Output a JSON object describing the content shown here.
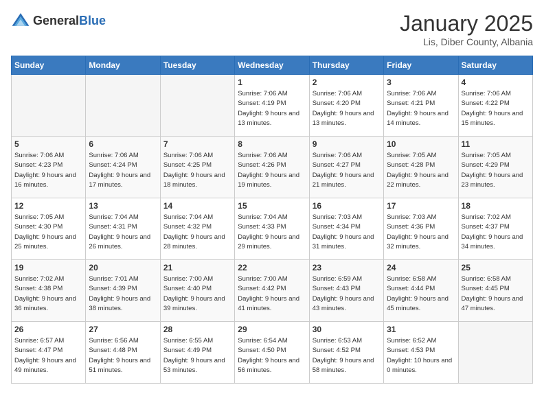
{
  "header": {
    "logo_general": "General",
    "logo_blue": "Blue",
    "month": "January 2025",
    "location": "Lis, Diber County, Albania"
  },
  "days_of_week": [
    "Sunday",
    "Monday",
    "Tuesday",
    "Wednesday",
    "Thursday",
    "Friday",
    "Saturday"
  ],
  "weeks": [
    [
      {
        "num": "",
        "sunrise": "",
        "sunset": "",
        "daylight": "",
        "empty": true
      },
      {
        "num": "",
        "sunrise": "",
        "sunset": "",
        "daylight": "",
        "empty": true
      },
      {
        "num": "",
        "sunrise": "",
        "sunset": "",
        "daylight": "",
        "empty": true
      },
      {
        "num": "1",
        "sunrise": "Sunrise: 7:06 AM",
        "sunset": "Sunset: 4:19 PM",
        "daylight": "Daylight: 9 hours and 13 minutes."
      },
      {
        "num": "2",
        "sunrise": "Sunrise: 7:06 AM",
        "sunset": "Sunset: 4:20 PM",
        "daylight": "Daylight: 9 hours and 13 minutes."
      },
      {
        "num": "3",
        "sunrise": "Sunrise: 7:06 AM",
        "sunset": "Sunset: 4:21 PM",
        "daylight": "Daylight: 9 hours and 14 minutes."
      },
      {
        "num": "4",
        "sunrise": "Sunrise: 7:06 AM",
        "sunset": "Sunset: 4:22 PM",
        "daylight": "Daylight: 9 hours and 15 minutes."
      }
    ],
    [
      {
        "num": "5",
        "sunrise": "Sunrise: 7:06 AM",
        "sunset": "Sunset: 4:23 PM",
        "daylight": "Daylight: 9 hours and 16 minutes."
      },
      {
        "num": "6",
        "sunrise": "Sunrise: 7:06 AM",
        "sunset": "Sunset: 4:24 PM",
        "daylight": "Daylight: 9 hours and 17 minutes."
      },
      {
        "num": "7",
        "sunrise": "Sunrise: 7:06 AM",
        "sunset": "Sunset: 4:25 PM",
        "daylight": "Daylight: 9 hours and 18 minutes."
      },
      {
        "num": "8",
        "sunrise": "Sunrise: 7:06 AM",
        "sunset": "Sunset: 4:26 PM",
        "daylight": "Daylight: 9 hours and 19 minutes."
      },
      {
        "num": "9",
        "sunrise": "Sunrise: 7:06 AM",
        "sunset": "Sunset: 4:27 PM",
        "daylight": "Daylight: 9 hours and 21 minutes."
      },
      {
        "num": "10",
        "sunrise": "Sunrise: 7:05 AM",
        "sunset": "Sunset: 4:28 PM",
        "daylight": "Daylight: 9 hours and 22 minutes."
      },
      {
        "num": "11",
        "sunrise": "Sunrise: 7:05 AM",
        "sunset": "Sunset: 4:29 PM",
        "daylight": "Daylight: 9 hours and 23 minutes."
      }
    ],
    [
      {
        "num": "12",
        "sunrise": "Sunrise: 7:05 AM",
        "sunset": "Sunset: 4:30 PM",
        "daylight": "Daylight: 9 hours and 25 minutes."
      },
      {
        "num": "13",
        "sunrise": "Sunrise: 7:04 AM",
        "sunset": "Sunset: 4:31 PM",
        "daylight": "Daylight: 9 hours and 26 minutes."
      },
      {
        "num": "14",
        "sunrise": "Sunrise: 7:04 AM",
        "sunset": "Sunset: 4:32 PM",
        "daylight": "Daylight: 9 hours and 28 minutes."
      },
      {
        "num": "15",
        "sunrise": "Sunrise: 7:04 AM",
        "sunset": "Sunset: 4:33 PM",
        "daylight": "Daylight: 9 hours and 29 minutes."
      },
      {
        "num": "16",
        "sunrise": "Sunrise: 7:03 AM",
        "sunset": "Sunset: 4:34 PM",
        "daylight": "Daylight: 9 hours and 31 minutes."
      },
      {
        "num": "17",
        "sunrise": "Sunrise: 7:03 AM",
        "sunset": "Sunset: 4:36 PM",
        "daylight": "Daylight: 9 hours and 32 minutes."
      },
      {
        "num": "18",
        "sunrise": "Sunrise: 7:02 AM",
        "sunset": "Sunset: 4:37 PM",
        "daylight": "Daylight: 9 hours and 34 minutes."
      }
    ],
    [
      {
        "num": "19",
        "sunrise": "Sunrise: 7:02 AM",
        "sunset": "Sunset: 4:38 PM",
        "daylight": "Daylight: 9 hours and 36 minutes."
      },
      {
        "num": "20",
        "sunrise": "Sunrise: 7:01 AM",
        "sunset": "Sunset: 4:39 PM",
        "daylight": "Daylight: 9 hours and 38 minutes."
      },
      {
        "num": "21",
        "sunrise": "Sunrise: 7:00 AM",
        "sunset": "Sunset: 4:40 PM",
        "daylight": "Daylight: 9 hours and 39 minutes."
      },
      {
        "num": "22",
        "sunrise": "Sunrise: 7:00 AM",
        "sunset": "Sunset: 4:42 PM",
        "daylight": "Daylight: 9 hours and 41 minutes."
      },
      {
        "num": "23",
        "sunrise": "Sunrise: 6:59 AM",
        "sunset": "Sunset: 4:43 PM",
        "daylight": "Daylight: 9 hours and 43 minutes."
      },
      {
        "num": "24",
        "sunrise": "Sunrise: 6:58 AM",
        "sunset": "Sunset: 4:44 PM",
        "daylight": "Daylight: 9 hours and 45 minutes."
      },
      {
        "num": "25",
        "sunrise": "Sunrise: 6:58 AM",
        "sunset": "Sunset: 4:45 PM",
        "daylight": "Daylight: 9 hours and 47 minutes."
      }
    ],
    [
      {
        "num": "26",
        "sunrise": "Sunrise: 6:57 AM",
        "sunset": "Sunset: 4:47 PM",
        "daylight": "Daylight: 9 hours and 49 minutes."
      },
      {
        "num": "27",
        "sunrise": "Sunrise: 6:56 AM",
        "sunset": "Sunset: 4:48 PM",
        "daylight": "Daylight: 9 hours and 51 minutes."
      },
      {
        "num": "28",
        "sunrise": "Sunrise: 6:55 AM",
        "sunset": "Sunset: 4:49 PM",
        "daylight": "Daylight: 9 hours and 53 minutes."
      },
      {
        "num": "29",
        "sunrise": "Sunrise: 6:54 AM",
        "sunset": "Sunset: 4:50 PM",
        "daylight": "Daylight: 9 hours and 56 minutes."
      },
      {
        "num": "30",
        "sunrise": "Sunrise: 6:53 AM",
        "sunset": "Sunset: 4:52 PM",
        "daylight": "Daylight: 9 hours and 58 minutes."
      },
      {
        "num": "31",
        "sunrise": "Sunrise: 6:52 AM",
        "sunset": "Sunset: 4:53 PM",
        "daylight": "Daylight: 10 hours and 0 minutes."
      },
      {
        "num": "",
        "sunrise": "",
        "sunset": "",
        "daylight": "",
        "empty": true
      }
    ]
  ]
}
